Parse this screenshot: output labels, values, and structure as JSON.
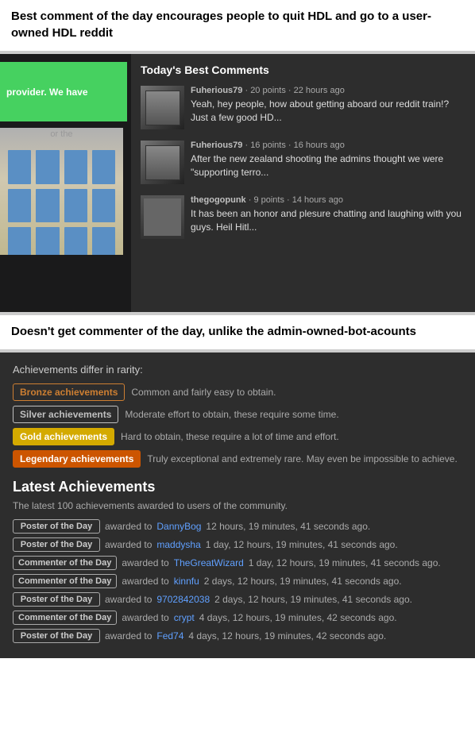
{
  "top_caption": {
    "text": "Best comment of the day encourages people to quit HDL and go to a user-owned HDL reddit"
  },
  "reddit_panel": {
    "left": {
      "green_box_text": "provider. We have",
      "building_alt": "building image"
    },
    "right": {
      "title": "Today's Best Comments",
      "comments": [
        {
          "username": "Fuherious79",
          "meta": "· 20 points · 22 hours ago",
          "text": "Yeah, hey people, how about getting aboard our reddit train!? Just a few good HD...",
          "thumb_class": "thumb-1"
        },
        {
          "username": "Fuherious79",
          "meta": "· 16 points · 16 hours ago",
          "text": "After the new zealand shooting the admins thought we were \"supporting terro...",
          "thumb_class": "thumb-2"
        },
        {
          "username": "thegogopunk",
          "meta": "· 9 points · 14 hours ago",
          "text": "It has been an honor and plesure chatting and laughing with you guys. Heil Hitl...",
          "thumb_class": "thumb-3"
        }
      ]
    }
  },
  "middle_caption": {
    "text": "Doesn't get commenter of the day, unlike the admin-owned-bot-acounts"
  },
  "achievements": {
    "differ_title": "Achievements differ in rarity:",
    "tiers": [
      {
        "badge_label": "Bronze achievements",
        "badge_class": "badge-bronze",
        "description": "Common and fairly easy to obtain."
      },
      {
        "badge_label": "Silver achievements",
        "badge_class": "badge-silver",
        "description": "Moderate effort to obtain, these require some time."
      },
      {
        "badge_label": "Gold achievements",
        "badge_class": "badge-gold",
        "description": "Hard to obtain, these require a lot of time and effort."
      },
      {
        "badge_label": "Legendary achievements",
        "badge_class": "badge-legendary",
        "description": "Truly exceptional and extremely rare. May even be impossible to achieve."
      }
    ],
    "latest_title": "Latest Achievements",
    "latest_subtitle": "The latest 100 achievements awarded to users of the community.",
    "awards": [
      {
        "badge": "Poster of the Day",
        "prefix": "awarded to",
        "username": "DannyBog",
        "time": "12 hours, 19 minutes, 41 seconds ago."
      },
      {
        "badge": "Poster of the Day",
        "prefix": "awarded to",
        "username": "maddysha",
        "time": "1 day, 12 hours, 19 minutes, 41 seconds ago."
      },
      {
        "badge": "Commenter of the Day",
        "prefix": "awarded to",
        "username": "TheGreatWizard",
        "time": "1 day, 12 hours, 19 minutes, 41 seconds ago."
      },
      {
        "badge": "Commenter of the Day",
        "prefix": "awarded to",
        "username": "kinnfu",
        "time": "2 days, 12 hours, 19 minutes, 41 seconds ago."
      },
      {
        "badge": "Poster of the Day",
        "prefix": "awarded to",
        "username": "9702842038",
        "time": "2 days, 12 hours, 19 minutes, 41 seconds ago."
      },
      {
        "badge": "Commenter of the Day",
        "prefix": "awarded to",
        "username": "crypt",
        "time": "4 days, 12 hours, 19 minutes, 42 seconds ago."
      },
      {
        "badge": "Poster of the Day",
        "prefix": "awarded to",
        "username": "Fed74",
        "time": "4 days, 12 hours, 19 minutes, 42 seconds ago."
      }
    ]
  }
}
